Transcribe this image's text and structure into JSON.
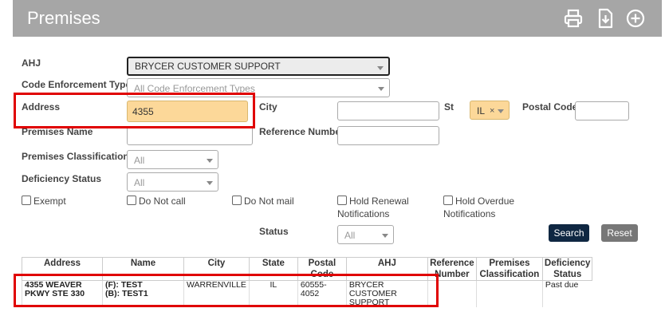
{
  "header": {
    "title": "Premises",
    "icons": [
      "print-icon",
      "download-icon",
      "add-icon"
    ]
  },
  "form": {
    "ahj": {
      "label": "AHJ",
      "value": "BRYCER CUSTOMER SUPPORT"
    },
    "code_enforcement_type": {
      "label": "Code Enforcement Type",
      "placeholder": "All Code Enforcement Types"
    },
    "address": {
      "label": "Address",
      "value": "4355"
    },
    "city": {
      "label": "City",
      "value": ""
    },
    "state": {
      "label": "St",
      "value": "IL",
      "clear": "×"
    },
    "postal_code": {
      "label": "Postal Code",
      "value": ""
    },
    "premises_name": {
      "label": "Premises Name",
      "value": ""
    },
    "reference_number": {
      "label": "Reference Number",
      "value": ""
    },
    "premises_classification": {
      "label": "Premises Classification",
      "value": "All"
    },
    "deficiency_status": {
      "label": "Deficiency Status",
      "value": "All"
    },
    "checkboxes": {
      "exempt": "Exempt",
      "do_not_call": "Do Not call",
      "do_not_mail": "Do Not mail",
      "hold_renewal": [
        "Hold Renewal",
        "Notifications"
      ],
      "hold_overdue": [
        "Hold Overdue",
        "Notifications"
      ]
    },
    "status": {
      "label": "Status",
      "value": "All"
    },
    "search_label": "Search",
    "reset_label": "Reset"
  },
  "table": {
    "headers": [
      [
        "Address"
      ],
      [
        "Name"
      ],
      [
        "City"
      ],
      [
        "State"
      ],
      [
        "Postal",
        "Code"
      ],
      [
        "AHJ"
      ],
      [
        "Reference",
        "Number"
      ],
      [
        "Premises",
        "Classification"
      ],
      [
        "Deficiency",
        "Status"
      ]
    ],
    "rows": [
      {
        "address": [
          "4355 WEAVER",
          "PKWY STE 330"
        ],
        "name": [
          "(F): TEST",
          "(B): TEST1"
        ],
        "city": "WARRENVILLE",
        "state": "IL",
        "postal": [
          "60555-",
          "4052"
        ],
        "ahj": [
          "BRYCER CUSTOMER",
          "SUPPORT"
        ],
        "reference": "",
        "classification": "",
        "deficiency": "Past due"
      }
    ]
  },
  "colors": {
    "header_bg": "#a6a6a6",
    "highlight": "#fcd899",
    "search_btn": "#0f2742",
    "reset_btn": "#777777",
    "annotation": "#e00000"
  }
}
